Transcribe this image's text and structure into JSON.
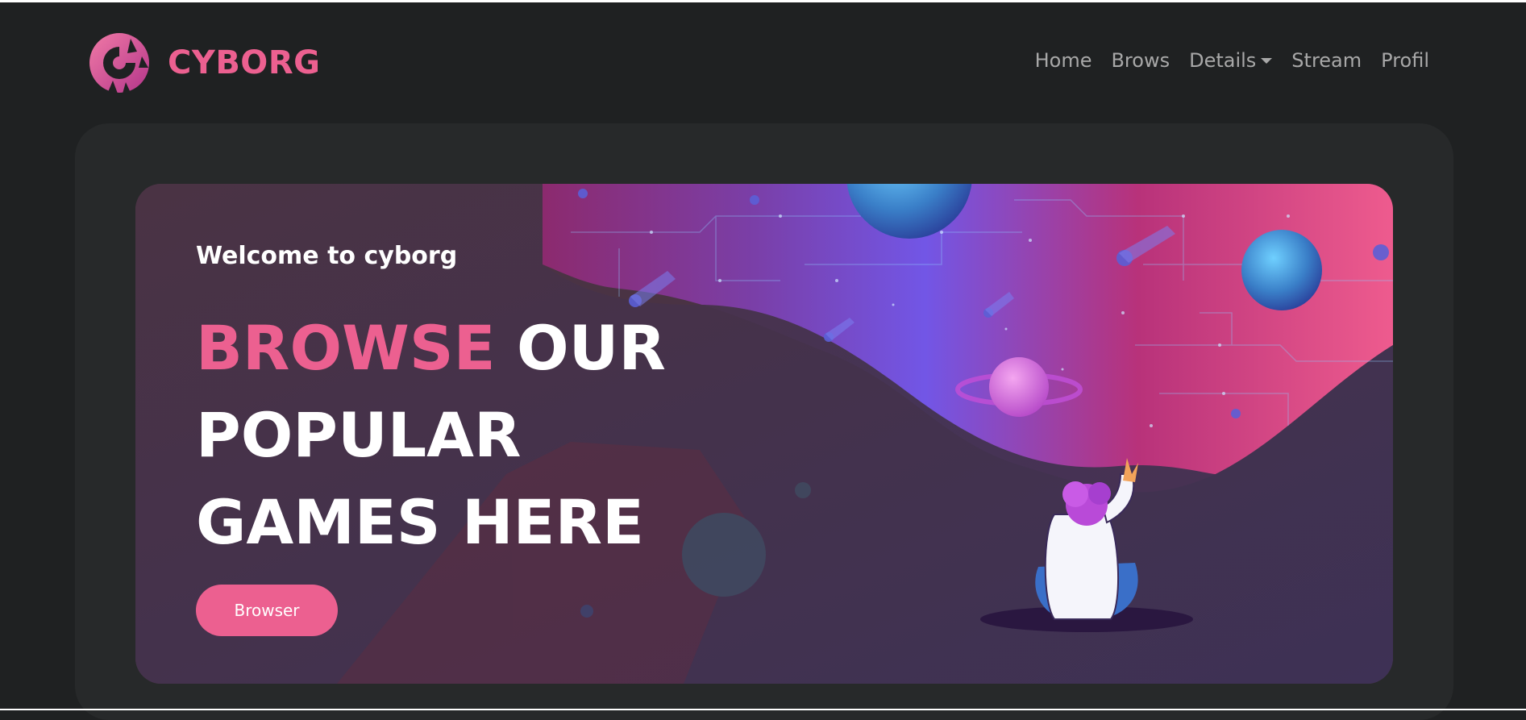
{
  "brand": {
    "name": "CYBORG",
    "accent": "#ec6090"
  },
  "nav": {
    "items": [
      {
        "label": "Home"
      },
      {
        "label": "Brows"
      },
      {
        "label": "Details",
        "has_dropdown": true
      },
      {
        "label": "Stream"
      },
      {
        "label": "Profil"
      }
    ]
  },
  "banner": {
    "welcome": "Welcome to cyborg",
    "headline_accent": "BROWSE",
    "headline_rest_1": "OUR",
    "headline_rest_2": "POPULAR",
    "headline_rest_3": "GAMES HERE",
    "button_label": "Browser"
  },
  "colors": {
    "background": "#1f2122",
    "content_panel": "#27292a",
    "nav_text": "#a8a8a8",
    "banner_base": "#4a3344"
  },
  "icons": {
    "logo": "cyborg-logo-icon",
    "dropdown": "caret-down-icon"
  }
}
